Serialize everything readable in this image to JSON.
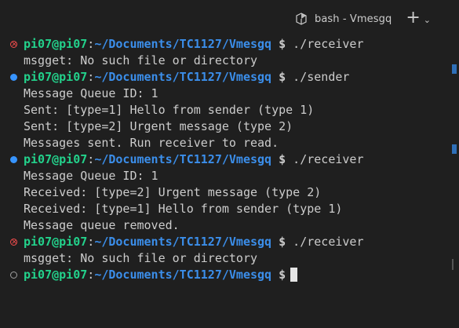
{
  "tab": {
    "title": "bash - Vmesgq",
    "icon": "terminal-icon",
    "new_terminal_icon": "plus-icon",
    "dropdown_icon": "chevron-down-icon"
  },
  "prompt": {
    "user_host": "pi07@pi07",
    "colon": ":",
    "path": "~/Documents/TC1127/Vmesgq",
    "dollar": "$"
  },
  "lines": [
    {
      "kind": "prompt",
      "status": "error",
      "command": " ./receiver"
    },
    {
      "kind": "output",
      "text": "msgget: No such file or directory"
    },
    {
      "kind": "prompt",
      "status": "success",
      "command": " ./sender"
    },
    {
      "kind": "output",
      "text": "Message Queue ID: 1"
    },
    {
      "kind": "output",
      "text": "Sent: [type=1] Hello from sender (type 1)"
    },
    {
      "kind": "output",
      "text": "Sent: [type=2] Urgent message (type 2)"
    },
    {
      "kind": "output",
      "text": "Messages sent. Run receiver to read."
    },
    {
      "kind": "prompt",
      "status": "success",
      "command": " ./receiver"
    },
    {
      "kind": "output",
      "text": "Message Queue ID: 1"
    },
    {
      "kind": "output",
      "text": "Received: [type=2] Urgent message (type 2)"
    },
    {
      "kind": "output",
      "text": "Received: [type=1] Hello from sender (type 1)"
    },
    {
      "kind": "output",
      "text": "Message queue removed."
    },
    {
      "kind": "prompt",
      "status": "error",
      "command": " ./receiver"
    },
    {
      "kind": "output",
      "text": "msgget: No such file or directory"
    },
    {
      "kind": "prompt",
      "status": "idle",
      "command": ""
    }
  ],
  "colors": {
    "background": "#1f1f1f",
    "user_host": "#23d18b",
    "path": "#3b8eea",
    "error_dot": "#f14c4c",
    "success_dot": "#3794ff"
  }
}
